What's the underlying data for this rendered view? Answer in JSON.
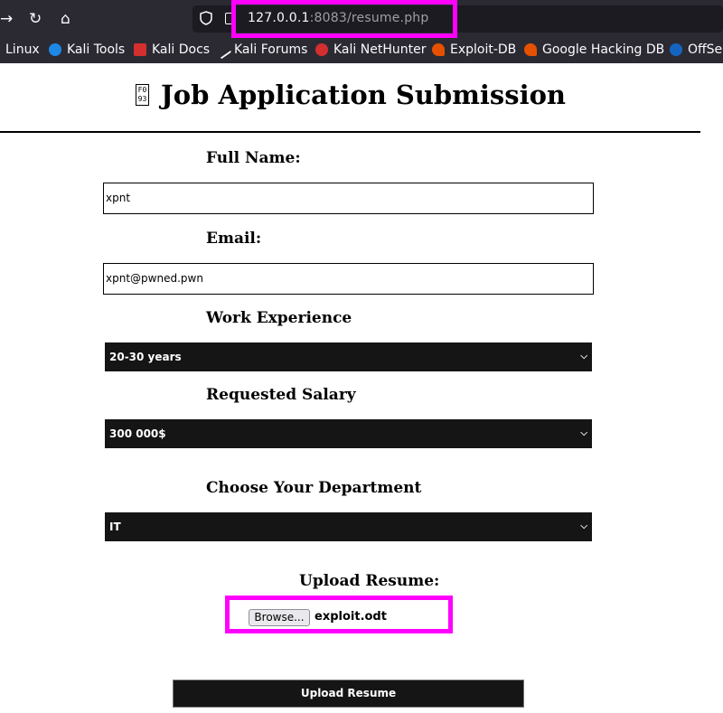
{
  "browser": {
    "url_host": "127.0.0.1",
    "url_rest": ":8083/resume.php",
    "bookmarks": [
      "Linux",
      "Kali Tools",
      "Kali Docs",
      "Kali Forums",
      "Kali NetHunter",
      "Exploit-DB",
      "Google Hacking DB",
      "OffSec"
    ],
    "bookmark_colors": [
      "",
      "#1e88e5",
      "#d32f2f",
      "",
      "#d32f2f",
      "#e65100",
      "#e65100",
      "#1565c0"
    ]
  },
  "page": {
    "title_glyph": "F0 93",
    "title": "Job Application Submission",
    "full_name_label": "Full Name:",
    "full_name_value": "xpnt",
    "email_label": "Email:",
    "email_value": "xpnt@pwned.pwn",
    "experience_label": "Work Experience",
    "experience_value": "20-30 years",
    "salary_label": "Requested Salary",
    "salary_value": "300 000$",
    "department_label": "Choose Your Department",
    "department_value": "IT",
    "upload_label": "Upload Resume:",
    "browse_label": "Browse...",
    "file_name": "exploit.odt",
    "submit_label": "Upload Resume"
  },
  "colors": {
    "highlight": "#ff00ff",
    "chrome_bg": "#2b2a33",
    "select_bg": "#151515"
  }
}
